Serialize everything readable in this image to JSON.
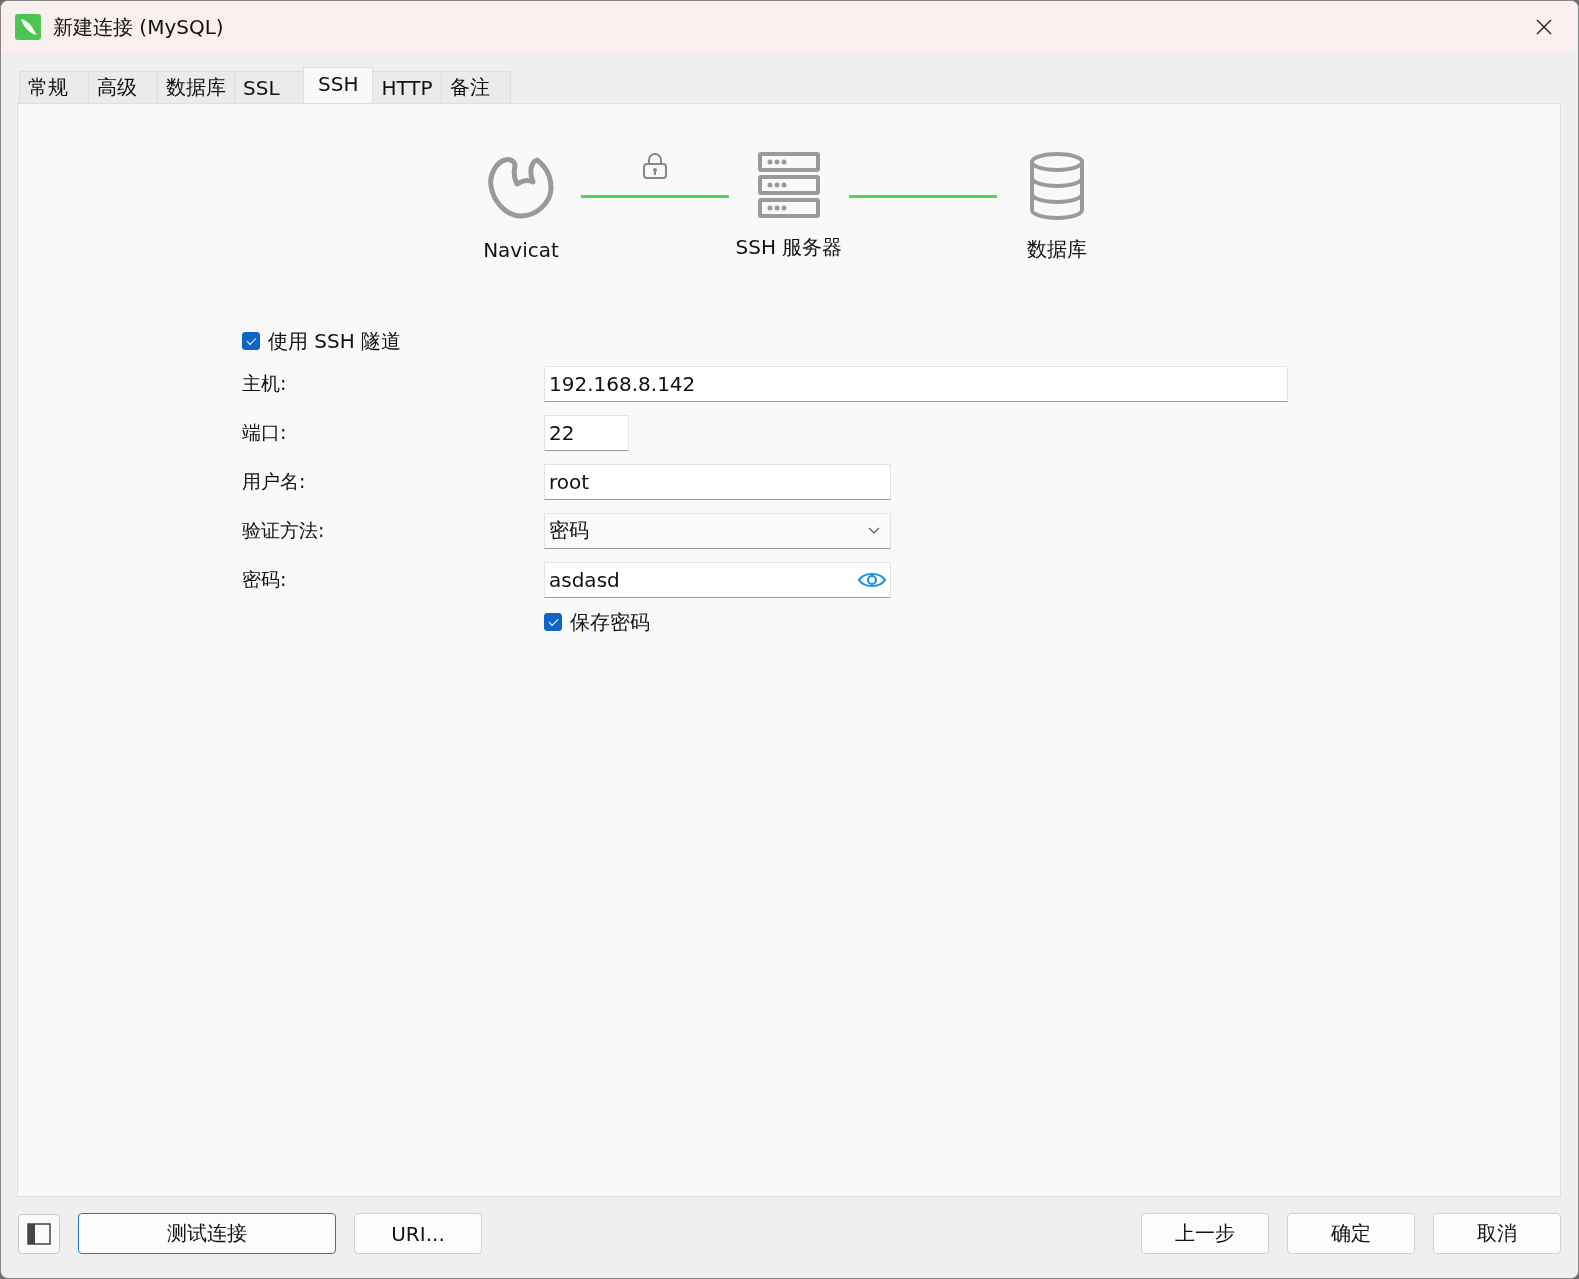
{
  "window": {
    "title": "新建连接 (MySQL)"
  },
  "tabs": [
    {
      "label": "常规",
      "selected": false
    },
    {
      "label": "高级",
      "selected": false
    },
    {
      "label": "数据库",
      "selected": false
    },
    {
      "label": "SSL",
      "selected": false
    },
    {
      "label": "SSH",
      "selected": true
    },
    {
      "label": "HTTP",
      "selected": false
    },
    {
      "label": "备注",
      "selected": false
    }
  ],
  "diagram": {
    "nodes": [
      {
        "kind": "client",
        "label": "Navicat"
      },
      {
        "kind": "server",
        "label": "SSH 服务器"
      },
      {
        "kind": "database",
        "label": "数据库"
      }
    ]
  },
  "use_ssh_tunnel": {
    "label": "使用 SSH 隧道",
    "checked": true
  },
  "fields": [
    {
      "kind": "text",
      "label": "主机:",
      "value": "192.168.8.142"
    },
    {
      "kind": "text",
      "label": "端口:",
      "value": "22"
    },
    {
      "kind": "text",
      "label": "用户名:",
      "value": "root"
    },
    {
      "kind": "select",
      "label": "验证方法:",
      "value": "密码"
    },
    {
      "kind": "password",
      "label": "密码:",
      "value": "asdasd"
    }
  ],
  "save_password": {
    "label": "保存密码",
    "checked": true
  },
  "footer": {
    "left_buttons": [
      {
        "label": "测试连接",
        "focused": true
      },
      {
        "label": "URI...",
        "focused": false
      }
    ],
    "right_buttons": [
      "上一步",
      "确定",
      "取消"
    ]
  }
}
